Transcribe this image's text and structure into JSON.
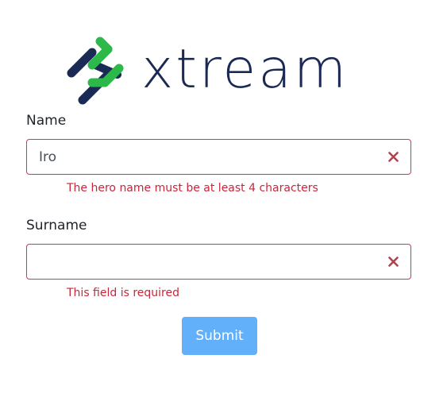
{
  "logo": {
    "text": "xtream",
    "icon": "xtream-chain-logo-icon",
    "colors": {
      "navy": "#1b2a54",
      "green": "#2db84a"
    }
  },
  "form": {
    "name": {
      "label": "Name",
      "value": "Iro",
      "placeholder": "",
      "error": "The hero name must be at least 4 characters",
      "clear_icon": "close-icon"
    },
    "surname": {
      "label": "Surname",
      "value": "",
      "placeholder": "",
      "error": "This field is required",
      "clear_icon": "close-icon"
    },
    "submit_label": "Submit"
  },
  "colors": {
    "error": "#dc3545",
    "button": "#62b0f9",
    "text": "#212529"
  }
}
